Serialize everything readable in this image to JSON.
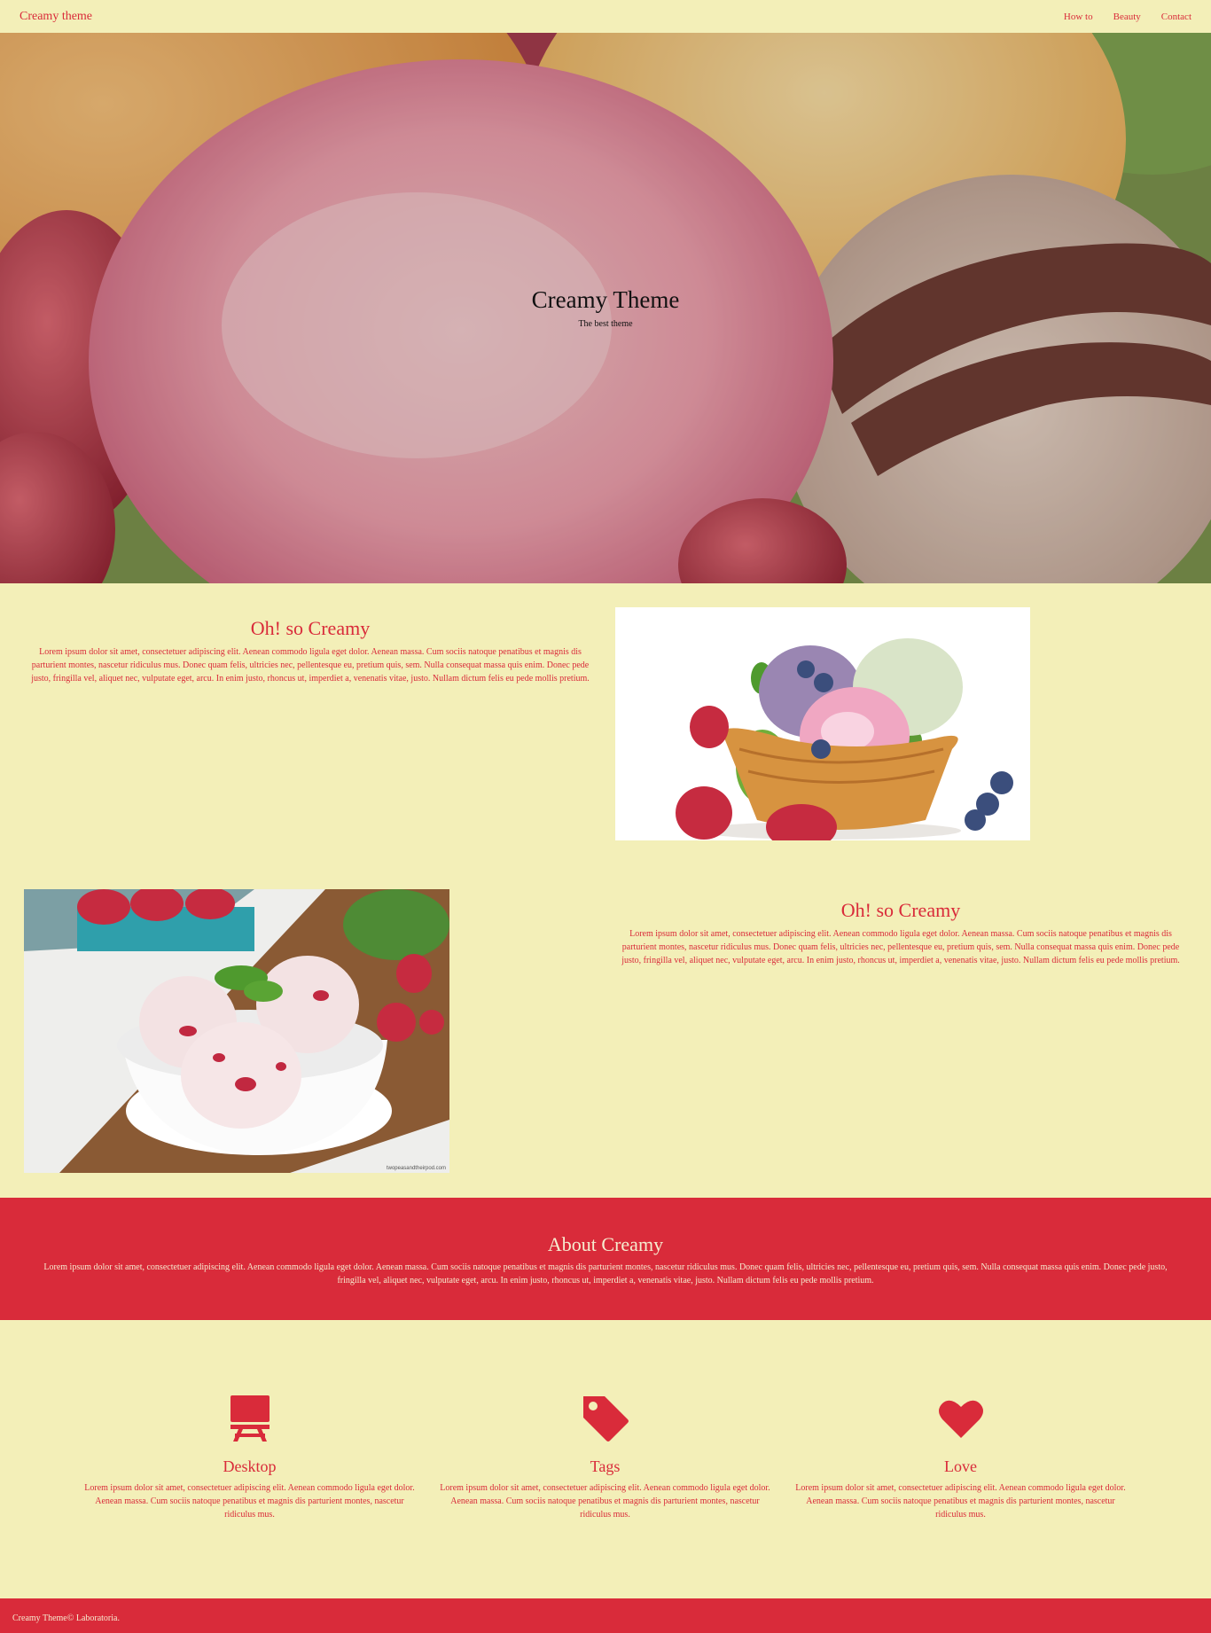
{
  "nav": {
    "brand": "Creamy theme",
    "links": [
      "How to",
      "Beauty",
      "Contact"
    ]
  },
  "hero": {
    "title": "Creamy Theme",
    "subtitle": "The best theme"
  },
  "features": [
    {
      "title": "Oh! so Creamy",
      "body": "Lorem ipsum dolor sit amet, consectetuer adipiscing elit. Aenean commodo ligula eget dolor. Aenean massa. Cum sociis natoque penatibus et magnis dis parturient montes, nascetur ridiculus mus. Donec quam felis, ultricies nec, pellentesque eu, pretium quis, sem. Nulla consequat massa quis enim. Donec pede justo, fringilla vel, aliquet nec, vulputate eget, arcu. In enim justo, rhoncus ut, imperdiet a, venenatis vitae, justo. Nullam dictum felis eu pede mollis pretium."
    },
    {
      "title": "Oh! so Creamy",
      "body": "Lorem ipsum dolor sit amet, consectetuer adipiscing elit. Aenean commodo ligula eget dolor. Aenean massa. Cum sociis natoque penatibus et magnis dis parturient montes, nascetur ridiculus mus. Donec quam felis, ultricies nec, pellentesque eu, pretium quis, sem. Nulla consequat massa quis enim. Donec pede justo, fringilla vel, aliquet nec, vulputate eget, arcu. In enim justo, rhoncus ut, imperdiet a, venenatis vitae, justo. Nullam dictum felis eu pede mollis pretium."
    }
  ],
  "about": {
    "title": "About Creamy",
    "body": "Lorem ipsum dolor sit amet, consectetuer adipiscing elit. Aenean commodo ligula eget dolor. Aenean massa. Cum sociis natoque penatibus et magnis dis parturient montes, nascetur ridiculus mus. Donec quam felis, ultricies nec, pellentesque eu, pretium quis, sem. Nulla consequat massa quis enim. Donec pede justo, fringilla vel, aliquet nec, vulputate eget, arcu. In enim justo, rhoncus ut, imperdiet a, venenatis vitae, justo. Nullam dictum felis eu pede mollis pretium."
  },
  "columns": [
    {
      "icon": "desktop-icon",
      "title": "Desktop",
      "body": "Lorem ipsum dolor sit amet, consectetuer adipiscing elit. Aenean commodo ligula eget dolor. Aenean massa. Cum sociis natoque penatibus et magnis dis parturient montes, nascetur ridiculus mus."
    },
    {
      "icon": "tag-icon",
      "title": "Tags",
      "body": "Lorem ipsum dolor sit amet, consectetuer adipiscing elit. Aenean commodo ligula eget dolor. Aenean massa. Cum sociis natoque penatibus et magnis dis parturient montes, nascetur ridiculus mus."
    },
    {
      "icon": "heart-icon",
      "title": "Love",
      "body": "Lorem ipsum dolor sit amet, consectetuer adipiscing elit. Aenean commodo ligula eget dolor. Aenean massa. Cum sociis natoque penatibus et magnis dis parturient montes, nascetur ridiculus mus."
    }
  ],
  "images": {
    "second_credit": "twopeasandtheirpod.com"
  },
  "footer": {
    "text": "Creamy Theme© Laboratoria."
  },
  "colors": {
    "background": "#f3efb8",
    "accent": "#d92b3a",
    "accent_text": "#f6edd0"
  }
}
